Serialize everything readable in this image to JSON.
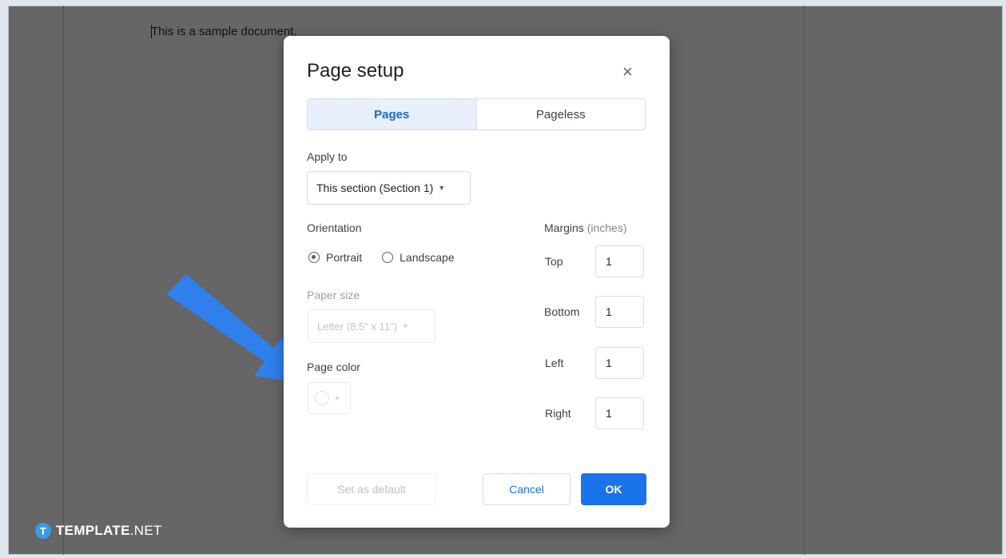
{
  "document": {
    "text": "This is a sample document."
  },
  "dialog": {
    "title": "Page setup",
    "close_icon": "×",
    "tabs": [
      {
        "label": "Pages",
        "active": true
      },
      {
        "label": "Pageless",
        "active": false
      }
    ],
    "apply_to": {
      "label": "Apply to",
      "value": "This section (Section 1)"
    },
    "orientation": {
      "label": "Orientation",
      "options": [
        {
          "label": "Portrait",
          "checked": true
        },
        {
          "label": "Landscape",
          "checked": false
        }
      ]
    },
    "paper_size": {
      "label": "Paper size",
      "value": "Letter (8.5\" x 11\")"
    },
    "page_color": {
      "label": "Page color",
      "swatch_color": "#ffffff"
    },
    "margins": {
      "label": "Margins",
      "unit": "(inches)",
      "top": {
        "label": "Top",
        "value": "1"
      },
      "bottom": {
        "label": "Bottom",
        "value": "1"
      },
      "left": {
        "label": "Left",
        "value": "1"
      },
      "right": {
        "label": "Right",
        "value": "1"
      }
    },
    "buttons": {
      "set_default": "Set as default",
      "cancel": "Cancel",
      "ok": "OK"
    }
  },
  "watermark": {
    "badge": "T",
    "brand_bold": "TEMPLATE",
    "brand_light": ".NET"
  },
  "colors": {
    "accent": "#1a73e8",
    "annotation_arrow": "#2f80ed",
    "backdrop": "#666666"
  }
}
